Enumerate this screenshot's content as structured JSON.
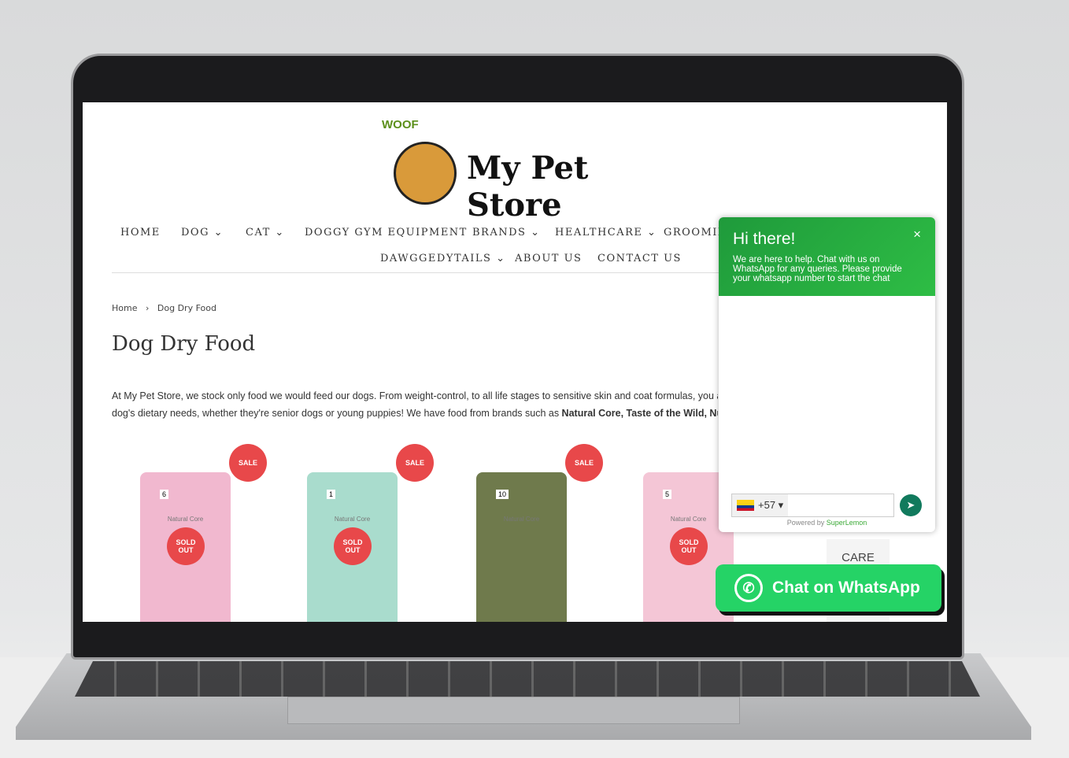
{
  "logo": {
    "woof": "WOOF",
    "name": "My Pet Store"
  },
  "nav": [
    "HOME",
    "DOG ⌄",
    "CAT ⌄",
    "DOGGY GYM EQUIPMENT",
    "BRANDS ⌄",
    "HEALTHCARE ⌄",
    "GROOMIN",
    "DAWGGEDYTAILS ⌄",
    "ABOUT US",
    "CONTACT US"
  ],
  "breadcrumb": {
    "home": "Home",
    "sep": "›",
    "current": "Dog Dry Food"
  },
  "page_title": "Dog Dry Food",
  "description": {
    "line1": "At My Pet Store, we stock only food we would feed our dogs. From weight-control, to all life stages to sensitive skin and coat formulas, you a",
    "line2": "dog's dietary needs, whether they're senior dogs or young puppies! We have food from brands such as ",
    "line2_bold": "Natural Core, Taste of the Wild, Nutrip"
  },
  "products": [
    {
      "brand": "Natural Core",
      "size": "6",
      "color": "#f1b8cf",
      "sale": "SALE",
      "sold_out": "SOLD OUT"
    },
    {
      "brand": "Natural Core",
      "size": "1",
      "color": "#a9dccd",
      "sale": "SALE",
      "sold_out": "SOLD OUT"
    },
    {
      "brand": "Natural Core",
      "size": "10",
      "color": "#6f7a4c",
      "sale": "SALE",
      "sold_out": ""
    },
    {
      "brand": "Natural Core",
      "size": "5",
      "color": "#f4c6d6",
      "sale": "",
      "sold_out": "SOLD OUT"
    }
  ],
  "care_label": "CARE",
  "chat": {
    "title": "Hi there!",
    "message": "We are here to help. Chat with us on WhatsApp for any queries. Please provide your whatsapp number to start the chat",
    "close": "×",
    "country_code": "+57 ▾",
    "powered_by": "Powered by ",
    "powered_brand": "SuperLemon",
    "send": "➤"
  },
  "whatsapp_button": "Chat on WhatsApp",
  "colors": {
    "chat_green": "#2ebd45",
    "whatsapp": "#25d366",
    "sale": "#e8484a"
  }
}
